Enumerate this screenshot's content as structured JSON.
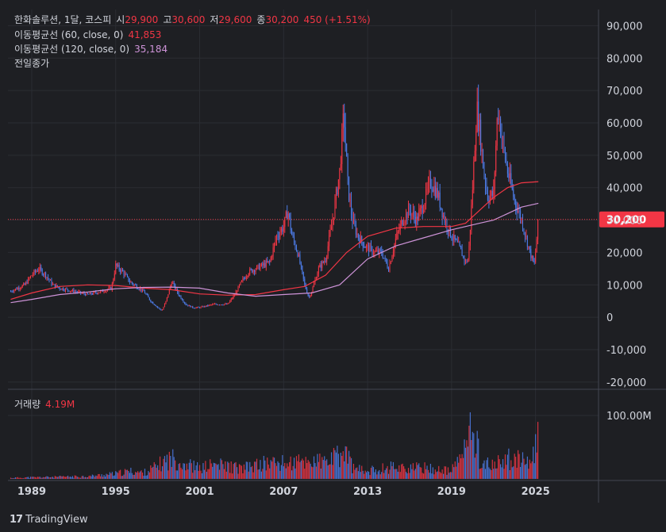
{
  "header": {
    "symbol": "한화솔루션, 1달, 코스피",
    "open_label": "시",
    "open_value": "29,900",
    "high_label": "고",
    "high_value": "30,600",
    "low_label": "저",
    "low_value": "29,600",
    "close_label": "종",
    "close_value": "30,200",
    "change": "450 (+1.51%)"
  },
  "ma60": {
    "label": "이동평균선 (60, close, 0)",
    "value": "41,853"
  },
  "ma120": {
    "label": "이동평균선 (120, close, 0)",
    "value": "35,184"
  },
  "prev_close_label": "전일종가",
  "volume_label": "거래량",
  "volume_value": "4.19M",
  "last_price_tag": "30,200",
  "brand": "TradingView",
  "colors": {
    "up": "#f23645",
    "down": "#4d7ce8",
    "ma60": "#f23645",
    "ma120": "#ce93d8",
    "bg": "#1e1f23",
    "grid": "#2b2d33",
    "text": "#d1d4dc"
  },
  "chart_data": {
    "type": "candlestick",
    "price_axis": {
      "ticks": [
        90000,
        80000,
        70000,
        60000,
        50000,
        40000,
        30000,
        20000,
        10000,
        0,
        -10000,
        -20000
      ],
      "tick_labels": [
        "90,000",
        "80,000",
        "70,000",
        "60,000",
        "50,000",
        "40,000",
        "30,000",
        "20,000",
        "10,000",
        "0",
        "-10,000",
        "-20,000"
      ],
      "range": [
        -22000,
        95000
      ]
    },
    "volume_axis": {
      "ticks": [
        100000000
      ],
      "tick_labels": [
        "100.00M"
      ],
      "range": [
        0,
        130000000
      ]
    },
    "time_axis": {
      "ticks": [
        1989,
        1995,
        2001,
        2007,
        2013,
        2019,
        2025
      ],
      "tick_labels": [
        "1989",
        "1995",
        "2001",
        "2007",
        "2013",
        "2019",
        "2025"
      ],
      "range": [
        1987.3,
        2029.5
      ]
    },
    "last_price": 30200,
    "price_series": {
      "x": [
        1987.5,
        1988.5,
        1989,
        1989.5,
        1990,
        1990.5,
        1991,
        1992,
        1993,
        1994,
        1994.7,
        1995,
        1995.5,
        1996,
        1997,
        1997.5,
        1998,
        1998.3,
        1998.6,
        1999,
        1999.5,
        2000,
        2000.5,
        2001,
        2002,
        2003,
        2003.5,
        2004,
        2004.5,
        2005,
        2006,
        2006.5,
        2007,
        2007.3,
        2007.6,
        2008,
        2008.5,
        2008.8,
        2009,
        2009.5,
        2010,
        2010.5,
        2011,
        2011.3,
        2011.6,
        2011.9,
        2012.3,
        2012.8,
        2013.5,
        2014,
        2014.5,
        2015,
        2015.5,
        2016,
        2016.5,
        2017,
        2017.5,
        2018,
        2018.5,
        2019,
        2019.5,
        2020,
        2020.2,
        2020.5,
        2020.8,
        2021,
        2021.3,
        2021.6,
        2022,
        2022.3,
        2022.6,
        2023,
        2023.5,
        2024,
        2024.3,
        2024.6,
        2024.9,
        2025,
        2025.2
      ],
      "close": [
        8000,
        10000,
        13000,
        15000,
        13000,
        10000,
        9000,
        8000,
        7000,
        8000,
        9000,
        16000,
        14000,
        11000,
        8000,
        5000,
        3000,
        2000,
        5000,
        11000,
        7000,
        4000,
        3000,
        3000,
        4000,
        4000,
        7000,
        11000,
        14000,
        15000,
        17000,
        25000,
        28000,
        33000,
        25000,
        20000,
        10000,
        6000,
        8000,
        15000,
        18000,
        30000,
        45000,
        63000,
        40000,
        30000,
        25000,
        22000,
        20000,
        20000,
        15000,
        24000,
        30000,
        33000,
        30000,
        35000,
        42000,
        38000,
        30000,
        25000,
        22000,
        17000,
        18000,
        40000,
        65000,
        58000,
        45000,
        37000,
        38000,
        65000,
        55000,
        45000,
        36000,
        30000,
        25000,
        20000,
        16000,
        20000,
        30200
      ]
    },
    "ma60": {
      "x": [
        1987.5,
        1989,
        1991,
        1993,
        1995,
        1997,
        1999,
        2001,
        2003,
        2005,
        2007,
        2008.5,
        2010,
        2011.5,
        2013,
        2015,
        2017,
        2019,
        2020,
        2021,
        2022,
        2023,
        2024,
        2025.2
      ],
      "y": [
        5500,
        7500,
        9500,
        10000,
        9800,
        9000,
        8500,
        7200,
        6800,
        7000,
        8500,
        9500,
        13000,
        20000,
        25000,
        27500,
        28000,
        28000,
        29000,
        33000,
        37000,
        40000,
        41500,
        41853
      ]
    },
    "ma120": {
      "x": [
        1987.5,
        1989,
        1991,
        1993,
        1995,
        1997,
        1999,
        2001,
        2003,
        2005,
        2007,
        2009,
        2011,
        2013,
        2015,
        2017,
        2019,
        2020,
        2021,
        2022,
        2023,
        2024,
        2025.2
      ],
      "y": [
        4500,
        5500,
        7000,
        7800,
        8800,
        9200,
        9300,
        9000,
        7500,
        6500,
        7000,
        7500,
        10000,
        18000,
        22000,
        24500,
        27000,
        28000,
        29000,
        30000,
        32000,
        34000,
        35184
      ]
    },
    "volume_series": {
      "x": [
        1987.5,
        1989,
        1991,
        1993,
        1995,
        1996,
        1997,
        1998,
        1998.5,
        1999,
        2000,
        2001,
        2002,
        2003,
        2004,
        2005,
        2006,
        2007,
        2008,
        2009,
        2010,
        2011,
        2011.5,
        2012,
        2013,
        2014,
        2015,
        2016,
        2017,
        2018,
        2019,
        2020,
        2020.4,
        2020.8,
        2021,
        2021.3,
        2022,
        2023,
        2024,
        2024.5,
        2025,
        2025.2
      ],
      "values": [
        2000000,
        3000000,
        4000000,
        5000000,
        10000000,
        15000000,
        12000000,
        25000000,
        35000000,
        40000000,
        30000000,
        20000000,
        28000000,
        25000000,
        20000000,
        26000000,
        32000000,
        30000000,
        32000000,
        35000000,
        32000000,
        45000000,
        50000000,
        20000000,
        15000000,
        20000000,
        25000000,
        20000000,
        22000000,
        18000000,
        15000000,
        60000000,
        95000000,
        75000000,
        40000000,
        30000000,
        25000000,
        40000000,
        35000000,
        28000000,
        60000000,
        100000000
      ]
    }
  }
}
